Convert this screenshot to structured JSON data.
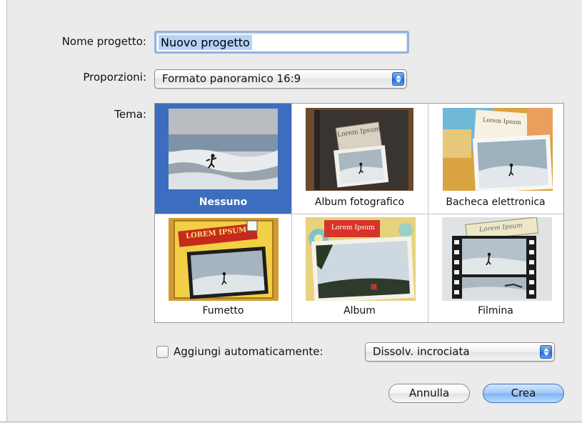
{
  "form": {
    "project_name_label": "Nome progetto:",
    "project_name_value": "Nuovo progetto",
    "aspect_label": "Proporzioni:",
    "aspect_value": "Formato panoramico 16:9",
    "theme_label": "Tema:"
  },
  "themes": [
    {
      "name": "Nessuno",
      "selected": true
    },
    {
      "name": "Album fotografico",
      "selected": false
    },
    {
      "name": "Bacheca elettronica",
      "selected": false
    },
    {
      "name": "Fumetto",
      "selected": false
    },
    {
      "name": "Album",
      "selected": false
    },
    {
      "name": "Filmina",
      "selected": false
    }
  ],
  "thumb_text": {
    "album_book": "Lorem Ipsum",
    "board": "Lorem Ipsum",
    "comic": "LOREM IPSUM",
    "album": "Lorem Ipsum",
    "filmstrip": "Lorem Ipsum"
  },
  "auto_add": {
    "label": "Aggiungi automaticamente:",
    "checked": false,
    "value": "Dissolv. incrociata"
  },
  "buttons": {
    "cancel": "Annulla",
    "create": "Crea"
  },
  "colors": {
    "selection": "#3d6dbf",
    "text_selection": "#b6d3f8",
    "focus_ring": "#8eb4e3",
    "default_button": "#7fb4f3"
  }
}
